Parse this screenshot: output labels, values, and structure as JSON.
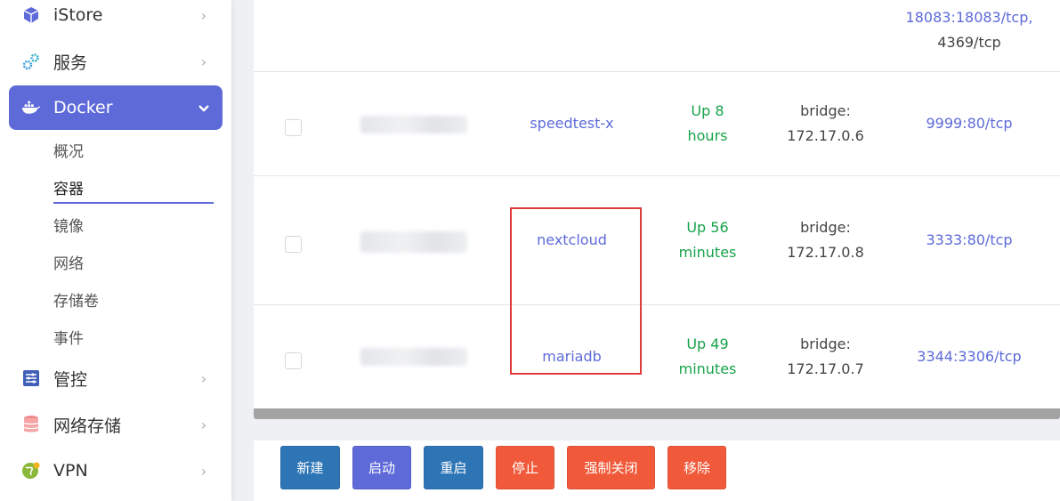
{
  "sidebar": {
    "items": [
      {
        "label": "iStore",
        "icon": "cube-icon"
      },
      {
        "label": "服务",
        "icon": "gears-icon"
      },
      {
        "label": "Docker",
        "icon": "docker-whale-icon"
      },
      {
        "label": "管控",
        "icon": "sliders-icon"
      },
      {
        "label": "网络存储",
        "icon": "database-icon"
      },
      {
        "label": "VPN",
        "icon": "globe-icon"
      }
    ],
    "docker_sub": [
      "概况",
      "容器",
      "镜像",
      "网络",
      "存储卷",
      "事件"
    ],
    "accent": "#5d6ad8"
  },
  "table": {
    "partial_row": {
      "ports_line1": "18083:18083/tcp,",
      "ports_line2": "4369/tcp"
    },
    "rows": [
      {
        "name": "speedtest-x",
        "status1": "Up 8",
        "status2": "hours",
        "network1": "bridge:",
        "network2": "172.17.0.6",
        "ports": "9999:80/tcp"
      },
      {
        "name": "nextcloud",
        "status1": "Up 56",
        "status2": "minutes",
        "network1": "bridge:",
        "network2": "172.17.0.8",
        "ports": "3333:80/tcp"
      },
      {
        "name": "mariadb",
        "status1": "Up 49",
        "status2": "minutes",
        "network1": "bridge:",
        "network2": "172.17.0.7",
        "ports": "3344:3306/tcp"
      }
    ]
  },
  "actions": {
    "new": "新建",
    "start": "启动",
    "restart": "重启",
    "stop": "停止",
    "force_close": "强制关闭",
    "remove": "移除"
  },
  "colors": {
    "link": "#5d6ad8",
    "status_green": "#17a34a",
    "highlight": "#e03b3b",
    "btn_blue": "#2e75b6",
    "btn_red": "#f05a3a"
  }
}
